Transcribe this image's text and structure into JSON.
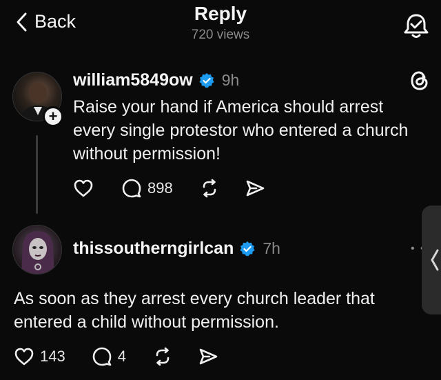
{
  "header": {
    "back_label": "Back",
    "title": "Reply",
    "views": "720 views"
  },
  "post": {
    "username": "william5849ow",
    "time": "9h",
    "text_lines": [
      "Raise your hand if America should arrest",
      "every single protestor who entered a church",
      "without permission!"
    ],
    "reply_count": "898"
  },
  "reply": {
    "username": "thissoutherngirlcan",
    "time": "7h",
    "text_lines": [
      "As soon as they arrest every church leader that",
      "entered a child without permission."
    ],
    "like_count": "143",
    "reply_count": "4"
  },
  "icons": {
    "back": "chevron-left-icon",
    "alert": "bell-check-icon",
    "threads": "threads-logo-icon",
    "verified": "verified-badge-icon",
    "like": "heart-icon",
    "comment": "comment-icon",
    "repost": "repost-icon",
    "share": "share-icon",
    "plus": "plus-icon",
    "side_panel": "chevron-left-icon"
  },
  "colors": {
    "background": "#0a0a0a",
    "verified": "#1d9bf0",
    "secondary_text": "#8a8a8a"
  }
}
